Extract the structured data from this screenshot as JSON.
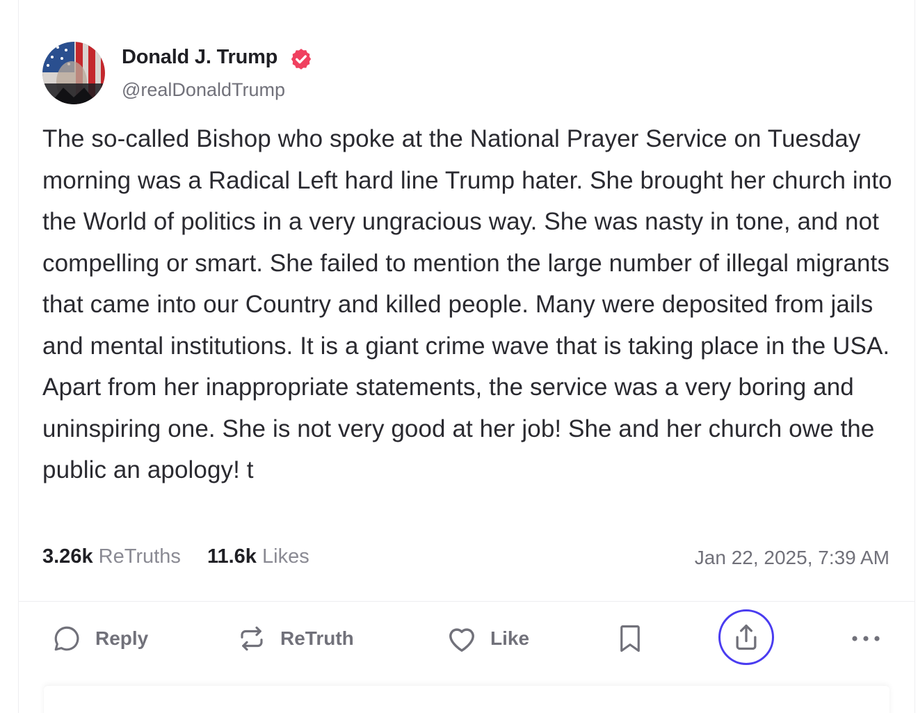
{
  "post": {
    "author_name": "Donald J. Trump",
    "author_handle": "@realDonaldTrump",
    "body": "The so-called Bishop who spoke at the National Prayer Service on Tuesday morning was a Radical Left hard line Trump hater. She brought her church into the World of politics in a very ungracious way. She was nasty in tone, and not compelling or smart. She failed to mention the large number of illegal migrants that came into our Country and killed people. Many were deposited from jails and mental institutions. It is a giant crime wave that is taking place in the USA. Apart from her inappropriate statements, the service was a very boring and uninspiring one. She is not very good at her job! She and her church owe the public an apology! t",
    "retruths_count": "3.26k",
    "retruths_label": "ReTruths",
    "likes_count": "11.6k",
    "likes_label": "Likes",
    "timestamp": "Jan 22, 2025, 7:39 AM"
  },
  "actions": {
    "reply_label": "Reply",
    "retruth_label": "ReTruth",
    "like_label": "Like"
  },
  "icons": {
    "verified": "verified-badge-icon",
    "reply": "speech-bubble-icon",
    "retruth": "repost-arrows-icon",
    "like": "heart-icon",
    "bookmark": "bookmark-icon",
    "share": "share-upload-icon",
    "more": "more-dots-icon"
  },
  "colors": {
    "verified": "#f0405f",
    "share_focus_ring": "#4a3cf0",
    "muted_text": "#71717a",
    "body_text": "#2a2a30"
  }
}
